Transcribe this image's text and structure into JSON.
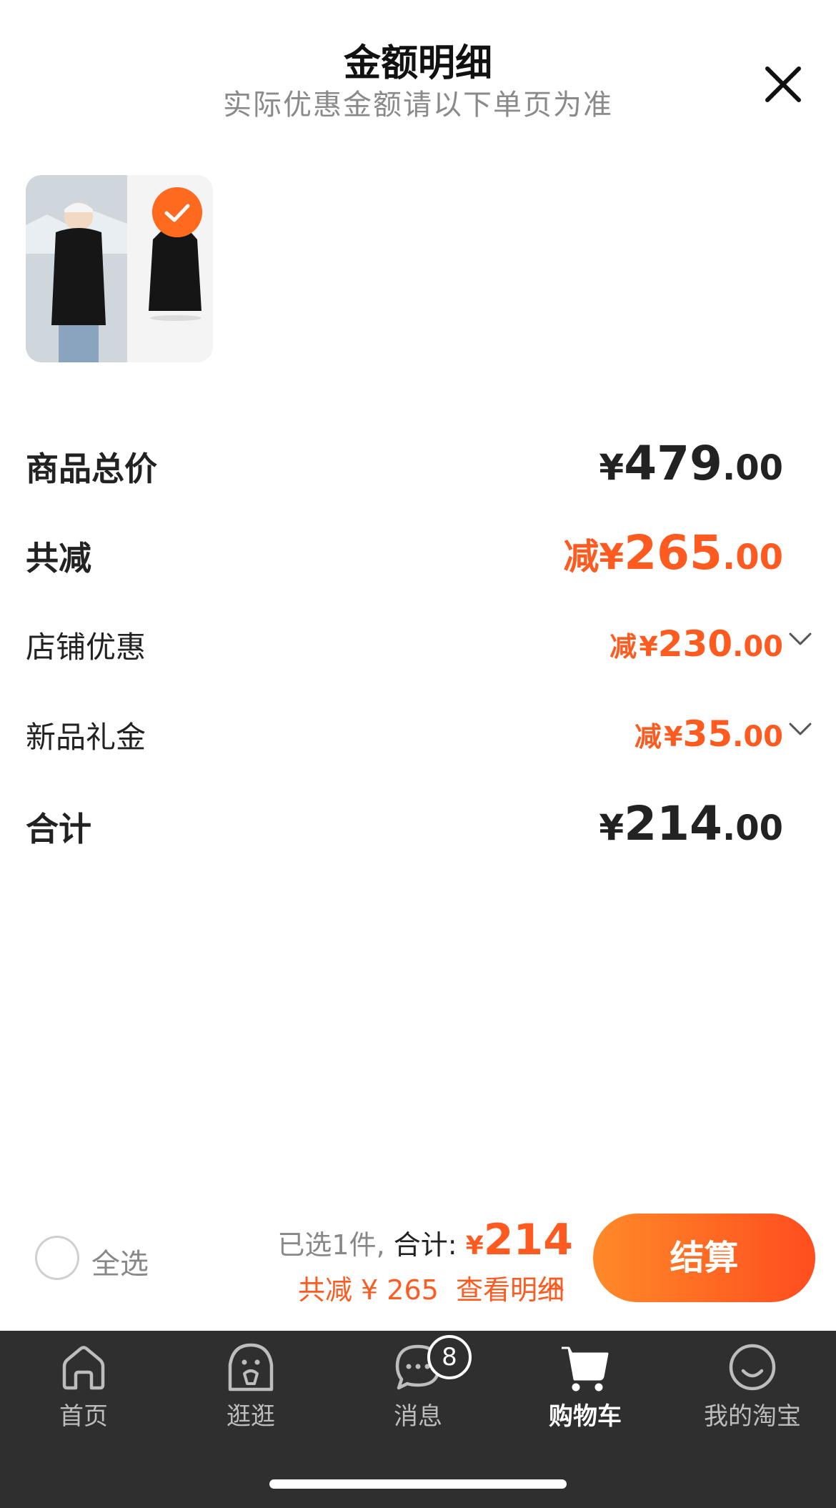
{
  "header": {
    "title": "金额明细",
    "subtitle": "实际优惠金额请以下单页为准"
  },
  "icons": [
    "close-icon",
    "check-icon",
    "chevron-down-icon",
    "chevron-up-icon",
    "home-icon",
    "explore-icon",
    "message-icon",
    "cart-icon",
    "profile-icon"
  ],
  "colors": {
    "accent": "#ff5a1f",
    "tabbar_bg": "#2f2f2f"
  },
  "product": {
    "selected": true
  },
  "breakdown": {
    "total": {
      "label": "商品总价",
      "currency": "¥",
      "integer": "479",
      "decimal": ".00"
    },
    "discount": {
      "label": "共减",
      "prefix": "减",
      "currency": "¥",
      "integer": "265",
      "decimal": ".00"
    },
    "items": [
      {
        "label": "店铺优惠",
        "prefix": "减",
        "currency": "¥",
        "integer": "230",
        "decimal": ".00"
      },
      {
        "label": "新品礼金",
        "prefix": "减",
        "currency": "¥",
        "integer": "35",
        "decimal": ".00"
      }
    ],
    "sum": {
      "label": "合计",
      "currency": "¥",
      "integer": "214",
      "decimal": ".00"
    }
  },
  "bottom_bar": {
    "select_all": "全选",
    "selected_text": "已选1件,",
    "total_label": "合计:",
    "total_currency": "¥",
    "total_amount": "214",
    "discount_summary": "共减 ¥ 265",
    "view_details": "查看明细",
    "checkout": "结算"
  },
  "tabbar": {
    "tabs": [
      {
        "label": "首页",
        "icon": "home-icon"
      },
      {
        "label": "逛逛",
        "icon": "explore-icon"
      },
      {
        "label": "消息",
        "icon": "message-icon",
        "badge": "8"
      },
      {
        "label": "购物车",
        "icon": "cart-icon",
        "active": true
      },
      {
        "label": "我的淘宝",
        "icon": "profile-icon"
      }
    ]
  }
}
